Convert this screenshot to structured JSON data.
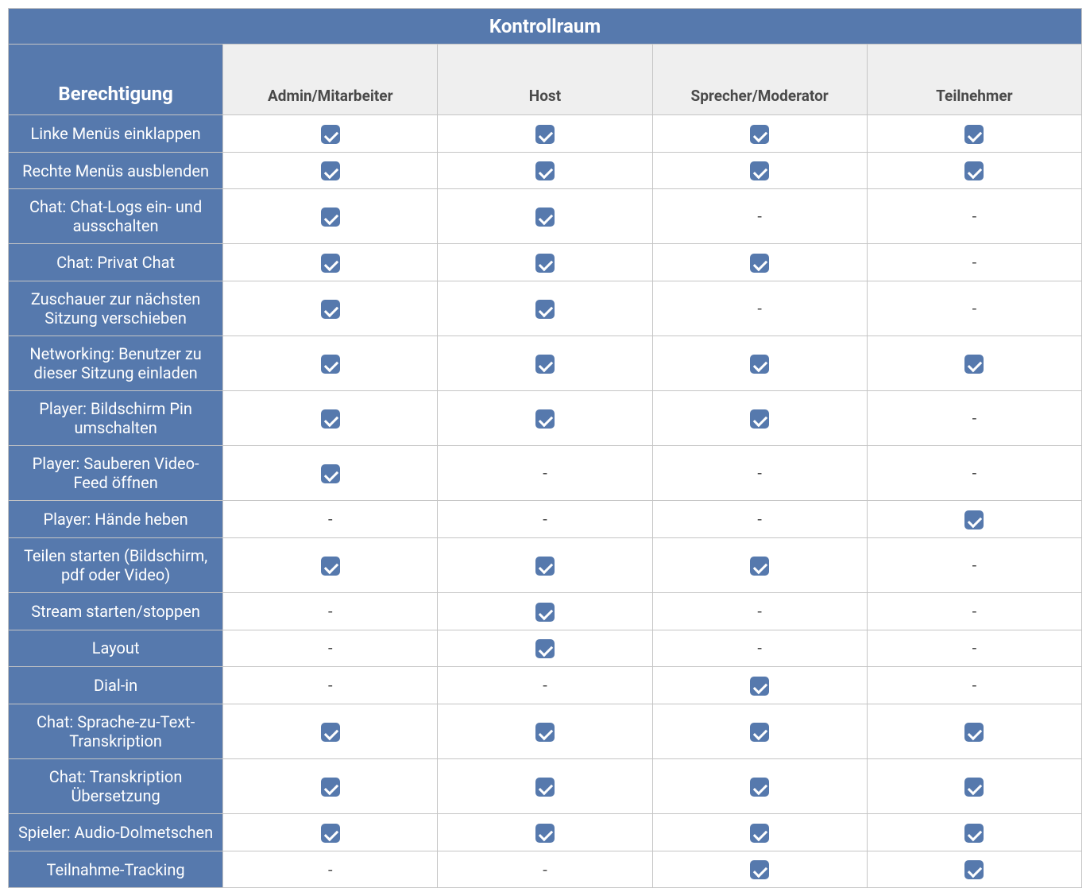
{
  "title": "Kontrollraum",
  "columns": {
    "permission": "Berechtigung",
    "roles": [
      "Admin/Mitarbeiter",
      "Host",
      "Sprecher/Moderator",
      "Teilnehmer"
    ]
  },
  "rows": [
    {
      "label": "Linke Menüs einklappen",
      "values": [
        true,
        true,
        true,
        true
      ]
    },
    {
      "label": "Rechte Menüs ausblenden",
      "values": [
        true,
        true,
        true,
        true
      ]
    },
    {
      "label": "Chat: Chat-Logs ein- und ausschalten",
      "values": [
        true,
        true,
        false,
        false
      ]
    },
    {
      "label": "Chat: Privat Chat",
      "values": [
        true,
        true,
        true,
        false
      ]
    },
    {
      "label": "Zuschauer zur nächsten Sitzung verschieben",
      "values": [
        true,
        true,
        false,
        false
      ]
    },
    {
      "label": "Networking: Benutzer zu dieser Sitzung einladen",
      "values": [
        true,
        true,
        true,
        true
      ]
    },
    {
      "label": "Player: Bildschirm Pin umschalten",
      "values": [
        true,
        true,
        true,
        false
      ]
    },
    {
      "label": "Player: Sauberen Video-Feed öffnen",
      "values": [
        true,
        false,
        false,
        false
      ]
    },
    {
      "label": "Player: Hände heben",
      "values": [
        false,
        false,
        false,
        true
      ]
    },
    {
      "label": "Teilen starten (Bildschirm, pdf oder Video)",
      "values": [
        true,
        true,
        true,
        false
      ]
    },
    {
      "label": "Stream starten/stoppen",
      "values": [
        false,
        true,
        false,
        false
      ]
    },
    {
      "label": "Layout",
      "values": [
        false,
        true,
        false,
        false
      ]
    },
    {
      "label": "Dial-in",
      "values": [
        false,
        false,
        true,
        false
      ]
    },
    {
      "label": "Chat: Sprache-zu-Text-Transkription",
      "values": [
        true,
        true,
        true,
        true
      ]
    },
    {
      "label": "Chat: Transkription Übersetzung",
      "values": [
        true,
        true,
        true,
        true
      ]
    },
    {
      "label": "Spieler: Audio-Dolmetschen",
      "values": [
        true,
        true,
        true,
        true
      ]
    },
    {
      "label": "Teilnahme-Tracking",
      "values": [
        false,
        false,
        true,
        true
      ]
    }
  ],
  "dash": "-"
}
